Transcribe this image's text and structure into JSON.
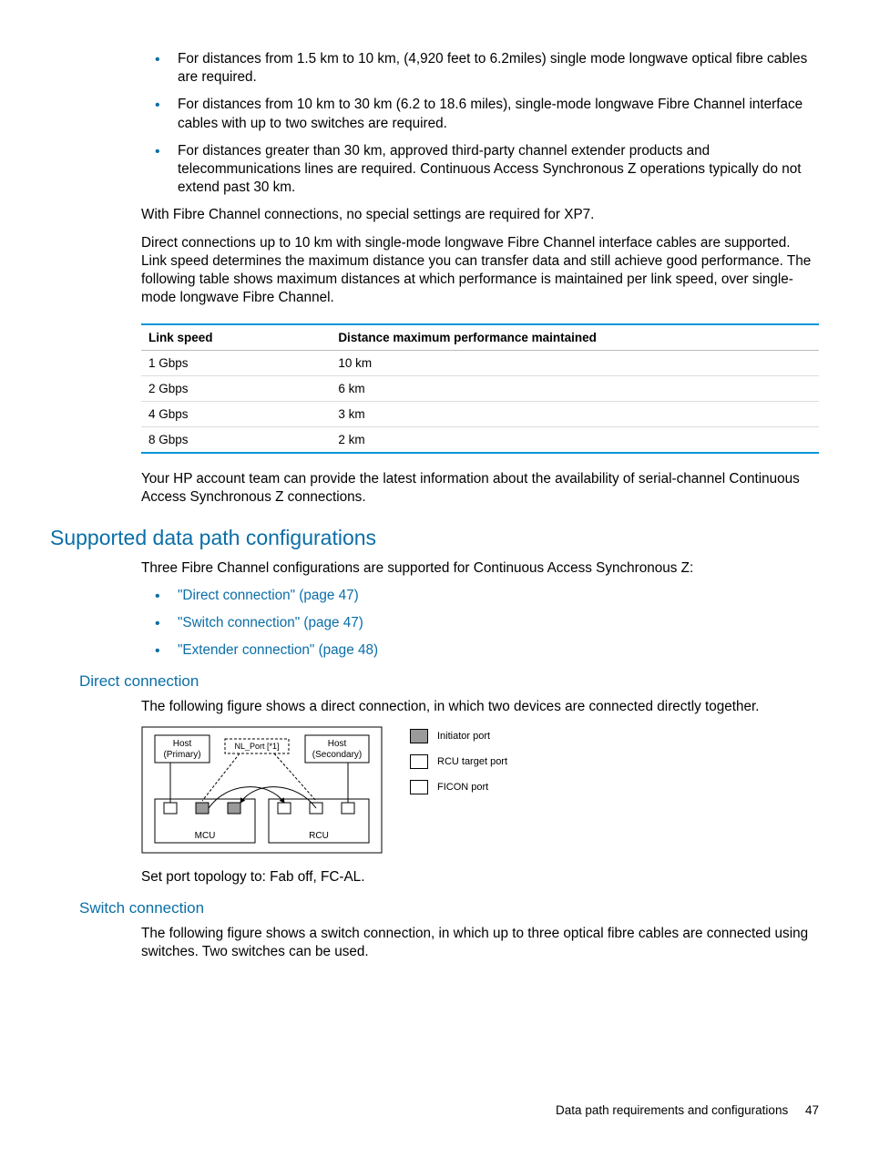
{
  "intro_bullets": [
    "For distances from 1.5 km to 10 km, (4,920 feet to 6.2miles) single mode longwave optical fibre cables are required.",
    "For distances from 10 km to 30 km (6.2 to 18.6 miles), single-mode longwave Fibre Channel interface cables with up to two switches are required.",
    "For distances greater than 30 km, approved third-party channel extender products and telecommunications lines are required. Continuous Access Synchronous Z operations typically do not extend past 30 km."
  ],
  "para_fc": "With Fibre Channel connections, no special settings are required for XP7.",
  "para_direct": "Direct connections up to 10 km with single-mode longwave Fibre Channel interface cables are supported. Link speed determines the maximum distance you can transfer data and still achieve good performance. The following table shows maximum distances at which performance is maintained per link speed, over single-mode longwave Fibre Channel.",
  "table": {
    "headers": [
      "Link speed",
      "Distance maximum performance maintained"
    ],
    "rows": [
      [
        "1 Gbps",
        "10 km"
      ],
      [
        "2 Gbps",
        "6 km"
      ],
      [
        "4 Gbps",
        "3 km"
      ],
      [
        "8 Gbps",
        "2 km"
      ]
    ]
  },
  "para_account": "Your HP account team can provide the latest information about the availability of serial-channel Continuous Access Synchronous Z connections.",
  "h2": "Supported data path configurations",
  "para_three": "Three Fibre Channel configurations are supported for Continuous Access Synchronous Z:",
  "config_links": [
    "\"Direct connection\" (page 47)",
    "\"Switch connection\" (page 47)",
    "\"Extender connection\" (page 48)"
  ],
  "h3_direct": "Direct connection",
  "para_direct_fig": "The following figure shows a direct connection, in which two devices are connected directly together.",
  "diagram": {
    "host_primary": "Host\n(Primary)",
    "host_secondary": "Host\n(Secondary)",
    "nl_port": "NL_Port [*1]",
    "mcu": "MCU",
    "rcu": "RCU",
    "legend": {
      "initiator": "Initiator port",
      "rcu_target": "RCU target port",
      "ficon": "FICON port"
    }
  },
  "para_port": "Set port topology to: Fab off, FC-AL.",
  "h3_switch": "Switch connection",
  "para_switch": "The following figure shows a switch connection, in which up to three optical fibre cables are connected using switches. Two switches can be used.",
  "footer": {
    "section": "Data path requirements and configurations",
    "page": "47"
  }
}
